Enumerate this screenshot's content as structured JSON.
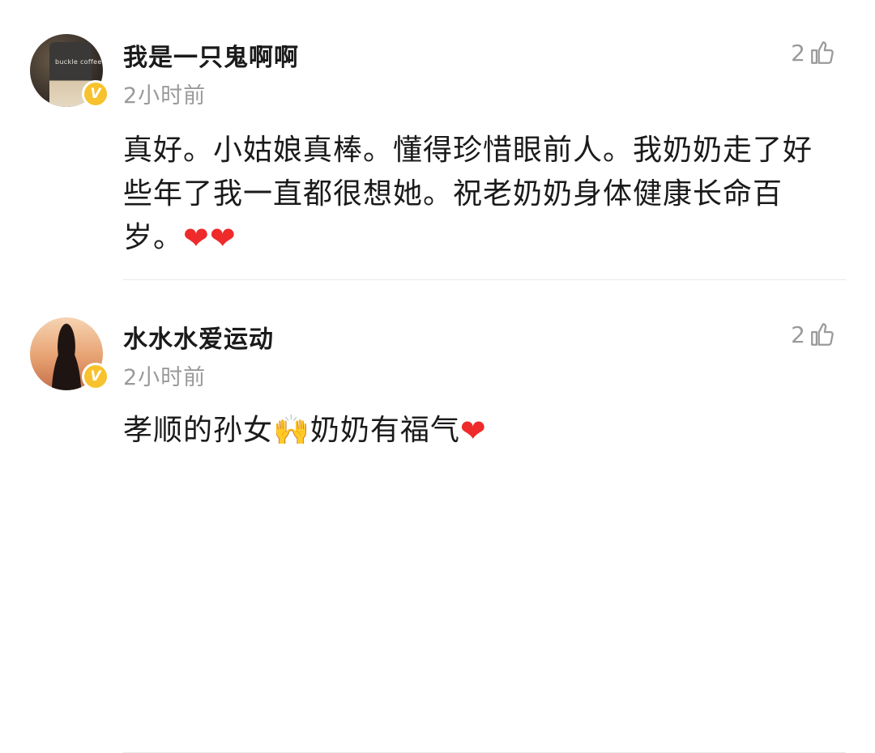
{
  "comments": [
    {
      "username": "我是一只鬼啊啊",
      "time": "2小时前",
      "likes": "2",
      "text": "真好。小姑娘真棒。懂得珍惜眼前人。我奶奶走了好些年了我一直都很想她。祝老奶奶身体健康长命百岁。",
      "trailing": "❤❤",
      "badge": "V",
      "avatar_caption": "buckle coffee"
    },
    {
      "username": "水水水爱运动",
      "time": "2小时前",
      "likes": "2",
      "text": "孝顺的孙女",
      "emoji": "🙌",
      "text_after": "奶奶有福气",
      "trailing": "❤",
      "badge": "V"
    }
  ],
  "colors": {
    "text": "#1a1a1a",
    "meta": "#9a9a9a",
    "badge": "#f7c22d",
    "heart": "#ee2a2a",
    "divider": "#e8e8e8"
  },
  "icons": {
    "like": "thumbs-up-icon",
    "verified": "verified-badge-icon",
    "heart": "heart-icon"
  }
}
